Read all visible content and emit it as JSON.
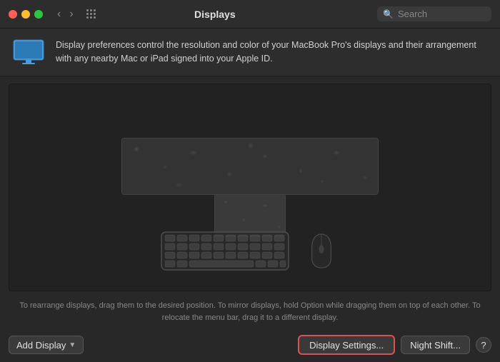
{
  "titlebar": {
    "title": "Displays",
    "search_placeholder": "Search",
    "back_icon": "‹",
    "forward_icon": "›"
  },
  "info": {
    "description": "Display preferences control the resolution and color of your MacBook Pro's displays and their arrangement with any nearby Mac or iPad signed into your Apple ID."
  },
  "instruction": {
    "text": "To rearrange displays, drag them to the desired position. To mirror displays, hold Option while dragging them on top of each other. To relocate the menu bar, drag it to a different display."
  },
  "toolbar": {
    "add_display_label": "Add Display",
    "display_settings_label": "Display Settings...",
    "night_shift_label": "Night Shift...",
    "question_label": "?"
  }
}
